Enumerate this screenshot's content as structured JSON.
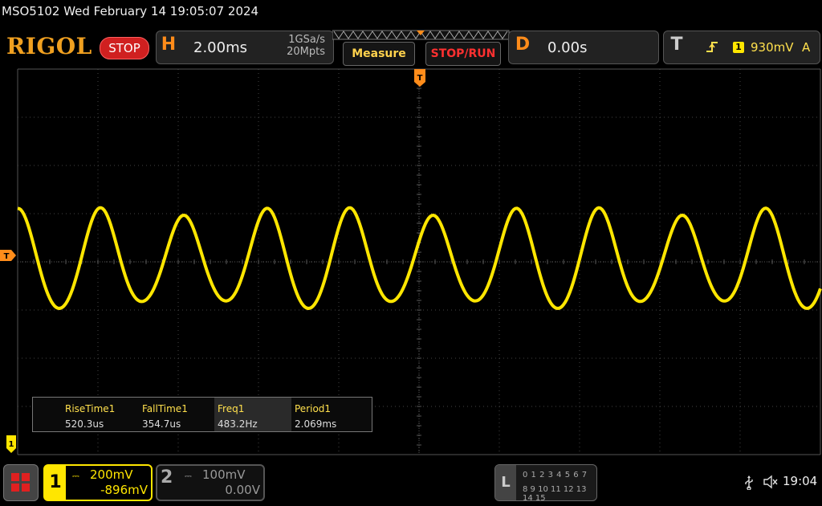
{
  "header": {
    "device_title": "MSO5102  Wed February 14 19:05:07 2024",
    "logo": "RIGOL",
    "run_status": "STOP"
  },
  "horizontal": {
    "label": "H",
    "timebase": "2.00ms",
    "sample_rate": "1GSa/s",
    "memory_depth": "20Mpts"
  },
  "buttons": {
    "measure": "Measure",
    "stop_run": "STOP/RUN"
  },
  "delay": {
    "label": "D",
    "value": "0.00s"
  },
  "trigger": {
    "label": "T",
    "edge_icon": "rising-edge-icon",
    "source": "1",
    "level": "930mV",
    "mode": "A"
  },
  "markers": {
    "trigger_position": "T",
    "trigger_level": "T",
    "channel1_ground": "1"
  },
  "measurements": [
    {
      "name": "RiseTime1",
      "value": "520.3us"
    },
    {
      "name": "FallTime1",
      "value": "354.7us"
    },
    {
      "name": "Freq1",
      "value": "483.2Hz"
    },
    {
      "name": "Period1",
      "value": "2.069ms"
    }
  ],
  "channel1": {
    "number": "1",
    "coupling": "DC",
    "scale": "200mV",
    "offset": "-896mV",
    "color": "#ffe600"
  },
  "channel2": {
    "number": "2",
    "coupling": "DC",
    "scale": "100mV",
    "offset": "0.00V"
  },
  "logic": {
    "label": "L",
    "row1": "0 1 2 3   4 5 6 7",
    "row2": "8 9 10 11 12 13 14 15"
  },
  "status": {
    "usb_icon": "usb-icon",
    "sound_icon": "mute-icon",
    "time": "19:04"
  },
  "colors": {
    "trace": "#ffe600",
    "accent": "#ff8c1a",
    "stop": "#d02020"
  }
}
